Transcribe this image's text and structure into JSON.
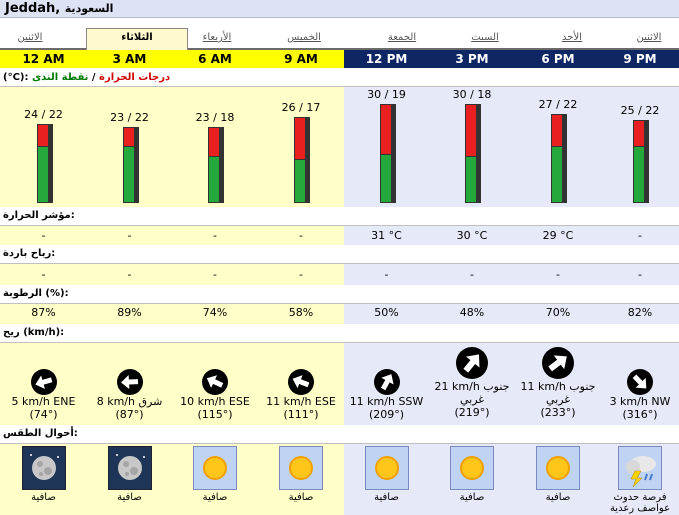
{
  "location": {
    "city": "Jeddah,",
    "country": "السعودية"
  },
  "days": [
    "الاثنين",
    "الثلاثاء",
    "الأربعاء",
    "الخميس",
    "الجمعة",
    "السبت",
    "الأحد",
    "الاثنين"
  ],
  "times": [
    "12 AM",
    "3 AM",
    "6 AM",
    "9 AM",
    "12 PM",
    "3 PM",
    "6 PM",
    "9 PM"
  ],
  "labels": {
    "temp_prefix": "(°C):",
    "temp": "درجات الحرارة",
    "sep": " / ",
    "dew": "نقطة الندى",
    "heat_index": "مؤشر الحرارة:",
    "wind_chill": "رياح باردة:",
    "humidity": "الرطوبة (%):",
    "wind": "ريح (km/h):",
    "conditions": "أحوال الطقس:"
  },
  "temps": [
    "24 / 22",
    "23 / 22",
    "23 / 18",
    "26 / 17",
    "30 / 19",
    "30 / 18",
    "27 / 22",
    "25 / 22"
  ],
  "chart_data": {
    "type": "bar",
    "categories": [
      "12 AM",
      "3 AM",
      "6 AM",
      "9 AM",
      "12 PM",
      "3 PM",
      "6 PM",
      "9 PM"
    ],
    "series": [
      {
        "name": "درجات الحرارة",
        "values": [
          24,
          23,
          23,
          26,
          30,
          30,
          27,
          25
        ]
      },
      {
        "name": "نقطة الندى",
        "values": [
          22,
          22,
          18,
          17,
          19,
          18,
          22,
          22
        ]
      }
    ]
  },
  "heat_index": [
    "-",
    "-",
    "-",
    "-",
    "31 °C",
    "30 °C",
    "29 °C",
    "-"
  ],
  "wind_chill": [
    "-",
    "-",
    "-",
    "-",
    "-",
    "-",
    "-",
    "-"
  ],
  "humidity": [
    "87%",
    "89%",
    "74%",
    "58%",
    "50%",
    "48%",
    "70%",
    "82%"
  ],
  "winds": [
    {
      "line1": "5 km/h ENE",
      "line2": "(74°)",
      "deg": 74
    },
    {
      "line1": "8 km/h شرق",
      "line2": "(87°)",
      "deg": 87
    },
    {
      "line1": "10 km/h ESE",
      "line2": "(115°)",
      "deg": 115
    },
    {
      "line1": "11 km/h ESE",
      "line2": "(111°)",
      "deg": 111
    },
    {
      "line1": "11 km/h SSW",
      "line2": "(209°)",
      "deg": 209
    },
    {
      "line1": "21 km/h جنوب",
      "line2": "غربي",
      "line3": "(219°)",
      "deg": 219
    },
    {
      "line1": "11 km/h جنوب",
      "line2": "غربي",
      "line3": "(233°)",
      "deg": 233
    },
    {
      "line1": "3 km/h NW",
      "line2": "(316°)",
      "deg": 316
    }
  ],
  "conditions": [
    {
      "text": "صافية",
      "icon": "moon-icon"
    },
    {
      "text": "صافية",
      "icon": "moon-icon"
    },
    {
      "text": "صافية",
      "icon": "sun-icon"
    },
    {
      "text": "صافية",
      "icon": "sun-icon"
    },
    {
      "text": "صافية",
      "icon": "sun-icon"
    },
    {
      "text": "صافية",
      "icon": "sun-icon"
    },
    {
      "text": "صافية",
      "icon": "sun-icon"
    },
    {
      "text": "فرصة حدوث",
      "text2": "عواصف رعدية",
      "icon": "thunderstorm-icon"
    }
  ],
  "colors": {
    "day_header": "#ffff00",
    "night_header": "#0e2764",
    "day_bg": "#ffffc8",
    "night_bg": "#e6e9f7",
    "temp_bar": "#e82020",
    "dew_bar": "#25a83c"
  }
}
